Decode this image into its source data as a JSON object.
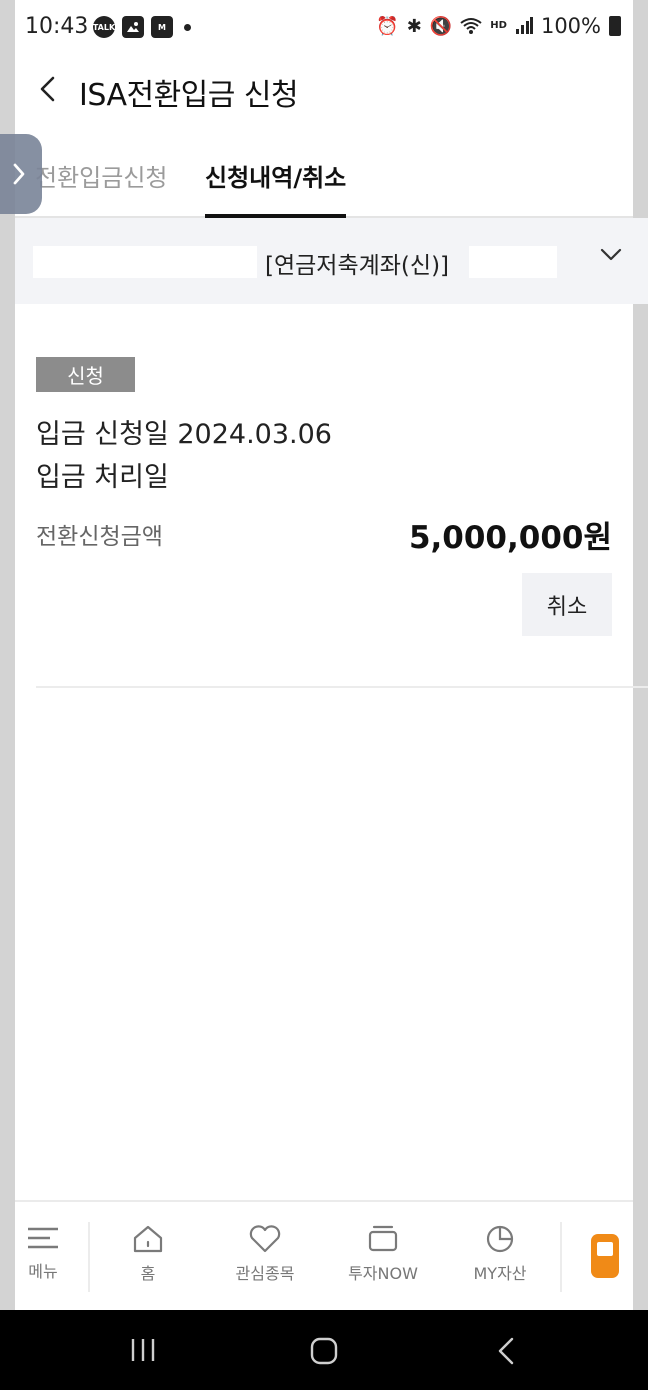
{
  "status_bar": {
    "time": "10:43",
    "battery": "100%",
    "icons_left": [
      "talk-icon",
      "gallery-icon",
      "mstock-icon"
    ],
    "icons_right": [
      "alarm-icon",
      "bluetooth-icon",
      "mute-icon",
      "wifi-icon",
      "hd-voice-icon",
      "signal-icon",
      "battery-icon"
    ]
  },
  "header": {
    "title": "ISA전환입금 신청"
  },
  "tabs": {
    "apply": "전환입금신청",
    "history": "신청내역/취소"
  },
  "account": {
    "name": "[연금저축계좌(신)]"
  },
  "record": {
    "badge": "신청",
    "apply_date": "입금 신청일 2024.03.06",
    "process_date": "입금 처리일",
    "amount_label": "전환신청금액",
    "amount_value": "5,000,000원",
    "cancel_label": "취소"
  },
  "bottom_nav": {
    "items": [
      {
        "label": "메뉴",
        "icon": "menu-icon"
      },
      {
        "label": "홈",
        "icon": "home-icon"
      },
      {
        "label": "관심종목",
        "icon": "heart-icon"
      },
      {
        "label": "투자NOW",
        "icon": "tv-icon"
      },
      {
        "label": "MY자산",
        "icon": "pie-chart-icon"
      }
    ],
    "accent_color": "#f08a17"
  }
}
